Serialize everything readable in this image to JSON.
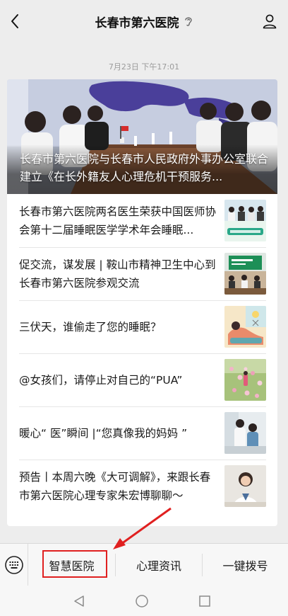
{
  "header": {
    "title": "长春市第六医院"
  },
  "timestamp": "7月23日 下午17:01",
  "card": {
    "hero": {
      "title": "长春市第六医院与长春市人民政府外事办公室联合建立《在长外籍友人心理危机干预服务..."
    },
    "articles": [
      {
        "title": "长春市第六医院两名医生荣获中国医师协会第十二届睡眠医学学术年会睡眠...",
        "thumb_icon": "award-photo"
      },
      {
        "title": "促交流，谋发展 | 鞍山市精神卫生中心到长春市第六医院参观交流",
        "thumb_icon": "visit-photo"
      },
      {
        "title": "三伏天，谁偷走了您的睡眠？",
        "thumb_icon": "sleep-illustration"
      },
      {
        "title": "@女孩们，请停止对自己的“PUA”",
        "thumb_icon": "flowers-photo"
      },
      {
        "title": "暖心“ 医”瞬间 |“您真像我的妈妈 ”",
        "thumb_icon": "nurse-photo"
      },
      {
        "title": "预告丨本周六晚《大可调解》，来跟长春市第六医院心理专家朱宏博聊聊～",
        "thumb_icon": "doctor-photo"
      }
    ]
  },
  "bottom_menu": {
    "items": [
      {
        "label": "智慧医院"
      },
      {
        "label": "心理资讯"
      },
      {
        "label": "一键拨号"
      }
    ]
  },
  "colors": {
    "highlight": "#e02020",
    "background": "#ededed"
  }
}
